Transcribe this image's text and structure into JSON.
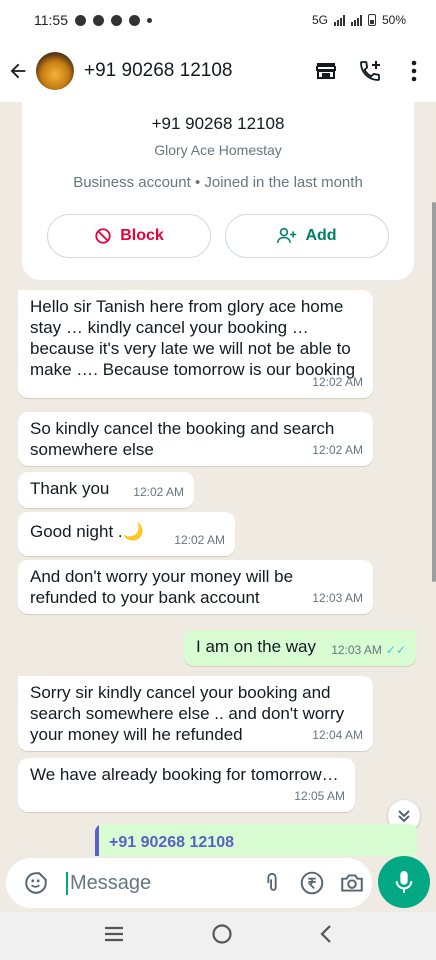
{
  "status_bar": {
    "time": "11:55",
    "network_label": "5G",
    "battery": "50%"
  },
  "header": {
    "title": "+91 90268 12108",
    "icons": [
      "back-arrow-icon",
      "avatar",
      "store-icon",
      "add-call-icon",
      "more-vert-icon"
    ]
  },
  "info_card": {
    "phone": "+91 90268 12108",
    "name": "Glory Ace Homestay",
    "business": "Business account • Joined in the last month",
    "block_label": "Block",
    "add_label": "Add"
  },
  "messages": [
    {
      "text": "Hello sir Tanish here from glory ace home stay … kindly cancel your booking … because it's very late we will not be able to make …. Because tomorrow is our booking",
      "time": "12:02 AM"
    },
    {
      "text": "So kindly cancel the booking and search somewhere else",
      "time": "12:02 AM"
    },
    {
      "text": "Thank you",
      "time": "12:02 AM"
    },
    {
      "text": "Good night .🌙",
      "time": "12:02 AM"
    },
    {
      "text": "And don't worry your money will be refunded to your bank account",
      "time": "12:03 AM"
    },
    {
      "text": "I am on the way",
      "time": "12:03 AM"
    },
    {
      "text": "Sorry sir kindly cancel your booking and search somewhere else .. and don't worry your money will he refunded",
      "time": "12:04 AM"
    },
    {
      "text": "We have already booking for tomorrow…",
      "time": "12:05 AM"
    }
  ],
  "contact_preview": "+91 90268 12108",
  "input": {
    "placeholder": "Message"
  },
  "colors": {
    "accent": "#00a884",
    "chat_bg": "#efeae2",
    "outgoing": "#d9fdd3",
    "block": "#ea0038",
    "read_ticks": "#53bdeb"
  }
}
